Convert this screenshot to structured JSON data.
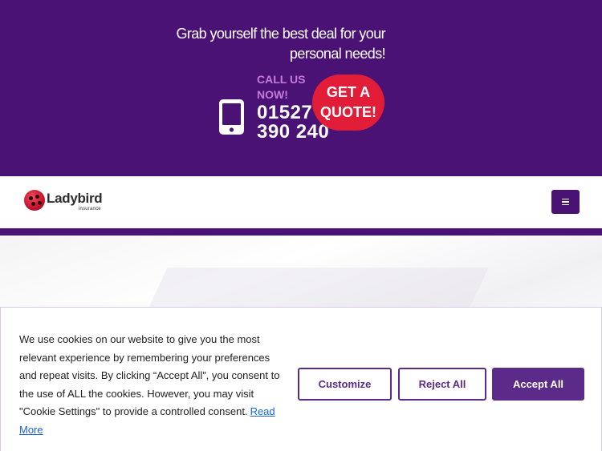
{
  "header": {
    "tagline": "Grab yourself the best deal for your personal needs!",
    "call_label": "CALL US NOW!",
    "phone_number": "01527 390 240",
    "quote_button": "GET A QUOTE!"
  },
  "nav": {
    "logo_text": "Ladybird",
    "logo_subtext": "insurance",
    "menu_icon": "hamburger-menu-icon"
  },
  "cookie_banner": {
    "message": "We use cookies on our website to give you the most relevant experience by remembering your preferences and repeat visits. By clicking “Accept All”, you consent to the use of ALL the cookies. However, you may visit \"Cookie Settings\" to provide a controlled consent.",
    "read_more": "Read More",
    "customize_label": "Customize",
    "reject_label": "Reject All",
    "accept_label": "Accept All"
  },
  "colors": {
    "brand_purple": "#4b1275",
    "accent_red": "#e21d37",
    "call_label_pink": "#c77bd9",
    "cookie_button_purple": "#5c2b8a",
    "link_blue": "#1863dc"
  }
}
